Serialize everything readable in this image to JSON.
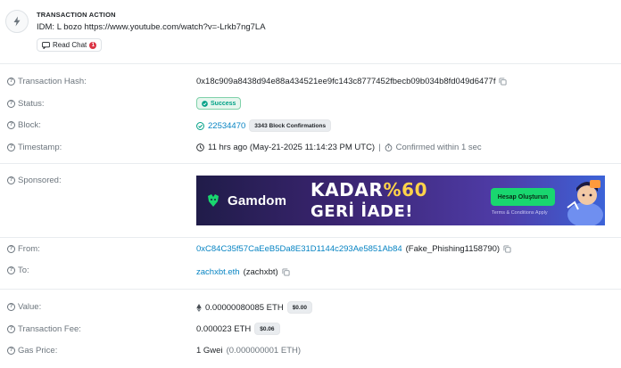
{
  "action": {
    "title": "TRANSACTION ACTION",
    "text": "IDM: L bozo https://www.youtube.com/watch?v=-Lrkb7ng7LA",
    "read_chat_label": "Read Chat",
    "chat_badge_count": "1"
  },
  "rows": {
    "tx_hash": {
      "label": "Transaction Hash:",
      "value": "0x18c909a8438d94e88a434521ee9fc143c8777452fbecb09b034b8fd049d6477f"
    },
    "status": {
      "label": "Status:",
      "value": "Success"
    },
    "block": {
      "label": "Block:",
      "number": "22534470",
      "confirmations": "3343 Block Confirmations"
    },
    "timestamp": {
      "label": "Timestamp:",
      "age": "11 hrs ago (May-21-2025 11:14:23 PM UTC)",
      "separator": "|",
      "confirmed": "Confirmed within 1 sec"
    },
    "sponsored": {
      "label": "Sponsored:"
    },
    "from": {
      "label": "From:",
      "address": "0xC84C35f57CaEeB5Da8E31D1144c293Ae5851Ab84",
      "tag": "(Fake_Phishing1158790)"
    },
    "to": {
      "label": "To:",
      "name": "zachxbt.eth",
      "tag": "(zachxbt)"
    },
    "value": {
      "label": "Value:",
      "amount": "0.00000080085 ETH",
      "usd": "$0.00"
    },
    "fee": {
      "label": "Transaction Fee:",
      "amount": "0.000023 ETH",
      "usd": "$0.06"
    },
    "gas": {
      "label": "Gas Price:",
      "amount": "1 Gwei",
      "detail": "(0.000000001 ETH)"
    }
  },
  "ad": {
    "brand": "Gamdom",
    "headline": "KADAR",
    "headline_pct": "%60",
    "sub": "GERİ İADE!",
    "cta": "Hesap Oluşturun",
    "terms": "Terms & Conditions Apply"
  },
  "icons": {
    "action": "lightning-icon",
    "help": "question-circle-icon",
    "copy": "copy-icon",
    "clock": "clock-icon",
    "stopwatch": "stopwatch-icon",
    "check": "check-circle-icon",
    "eth": "eth-diamond-icon"
  },
  "colors": {
    "link": "#0784c3",
    "success": "#00a186",
    "badge_red": "#dc3545",
    "muted": "#6c757d"
  }
}
